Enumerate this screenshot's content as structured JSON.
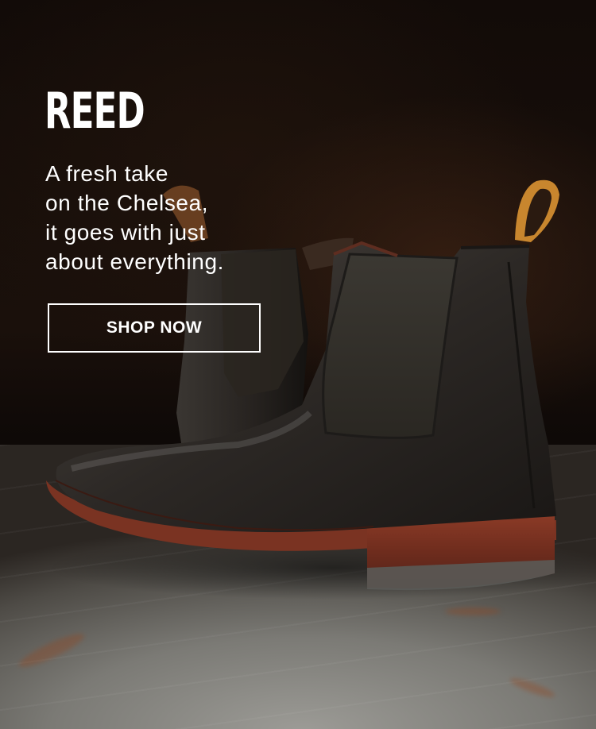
{
  "hero": {
    "brand": "REED",
    "tagline_lines": [
      "A fresh take",
      "on the Chelsea,",
      "it goes with just",
      "about everything."
    ],
    "cta_label": "SHOP NOW"
  },
  "colors": {
    "text": "#ffffff",
    "boot_leather": "#2e2a26",
    "sole": "#7a3322",
    "pull_tab": "#c8862e"
  },
  "image": {
    "alt": "Black leather Chelsea boots on a wooden floor"
  }
}
